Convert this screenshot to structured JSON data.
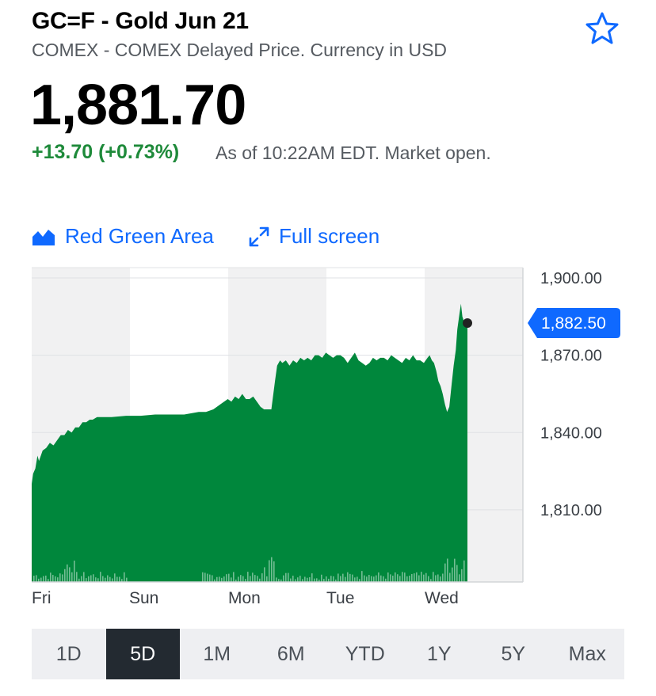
{
  "header": {
    "title": "GC=F - Gold Jun 21",
    "subtitle": "COMEX - COMEX Delayed Price. Currency in USD"
  },
  "quote": {
    "price": "1,881.70",
    "change": "+13.70 (+0.73%)",
    "as_of": "As of 10:22AM EDT. Market open."
  },
  "controls": {
    "chart_type_label": "Red Green Area",
    "fullscreen_label": "Full screen"
  },
  "colors": {
    "area": "#00873c",
    "accent": "#0f69ff",
    "positive": "#1e8a3a",
    "band": "#f1f1f2"
  },
  "chart_data": {
    "type": "area",
    "ylim": [
      1782,
      1904
    ],
    "y_ticks": [
      "1,900.00",
      "1,870.00",
      "1,840.00",
      "1,810.00"
    ],
    "y_tick_values": [
      1900,
      1870,
      1840,
      1810
    ],
    "x_labels": [
      "Fri",
      "Sun",
      "Mon",
      "Tue",
      "Wed"
    ],
    "current_value": 1882.5,
    "current_label": "1,882.50",
    "series": [
      {
        "x": [
          0,
          2,
          5,
          8,
          10,
          15,
          20,
          25,
          30,
          35,
          40,
          45,
          50,
          55,
          60,
          65,
          70,
          75,
          80,
          84,
          90,
          110,
          130,
          150,
          170,
          190,
          200,
          210,
          220,
          230,
          240,
          250,
          255,
          260,
          265,
          270,
          275,
          280,
          285,
          290,
          295,
          300,
          305,
          310,
          315,
          320,
          325,
          330,
          335,
          338,
          342,
          345,
          350,
          355,
          360,
          365,
          370,
          375,
          380,
          385,
          390,
          395,
          400,
          405,
          410,
          415,
          420,
          425,
          430,
          435,
          440,
          445,
          450,
          455,
          460,
          465,
          470,
          475,
          480,
          485,
          490,
          495,
          500,
          505,
          510,
          515,
          520,
          525,
          530,
          535,
          540,
          545,
          548,
          551,
          554,
          557,
          560,
          563,
          566,
          569,
          572,
          575,
          578,
          581,
          584,
          586,
          589,
          591,
          593,
          596,
          600
        ],
        "y": [
          1820,
          1824,
          1826,
          1831,
          1829,
          1833,
          1834,
          1836,
          1835,
          1837,
          1839,
          1839,
          1841,
          1840,
          1842,
          1842,
          1844,
          1844,
          1845,
          1845,
          1846,
          1846,
          1846.5,
          1846.5,
          1847,
          1847,
          1847,
          1847,
          1847.5,
          1848,
          1848,
          1849,
          1850,
          1851,
          1852,
          1853,
          1852,
          1854,
          1853,
          1855,
          1853,
          1853,
          1854,
          1852,
          1850,
          1849,
          1849,
          1849,
          1860,
          1866,
          1868,
          1867,
          1868,
          1866,
          1868,
          1867,
          1869,
          1868,
          1869,
          1868,
          1870,
          1870,
          1869,
          1871,
          1870,
          1869,
          1870,
          1870,
          1869,
          1867,
          1869,
          1871,
          1868,
          1867,
          1866,
          1867,
          1869,
          1868,
          1869,
          1869,
          1868,
          1870,
          1869,
          1868,
          1867,
          1869,
          1868,
          1870,
          1868,
          1868,
          1867,
          1869,
          1870,
          1868,
          1867,
          1864,
          1860,
          1858,
          1855,
          1851,
          1848,
          1850,
          1858,
          1866,
          1872,
          1880,
          1886,
          1890,
          1885,
          1882.5,
          1882.5
        ]
      }
    ]
  },
  "ranges": {
    "items": [
      "1D",
      "5D",
      "1M",
      "6M",
      "YTD",
      "1Y",
      "5Y",
      "Max"
    ],
    "selected": 1
  }
}
